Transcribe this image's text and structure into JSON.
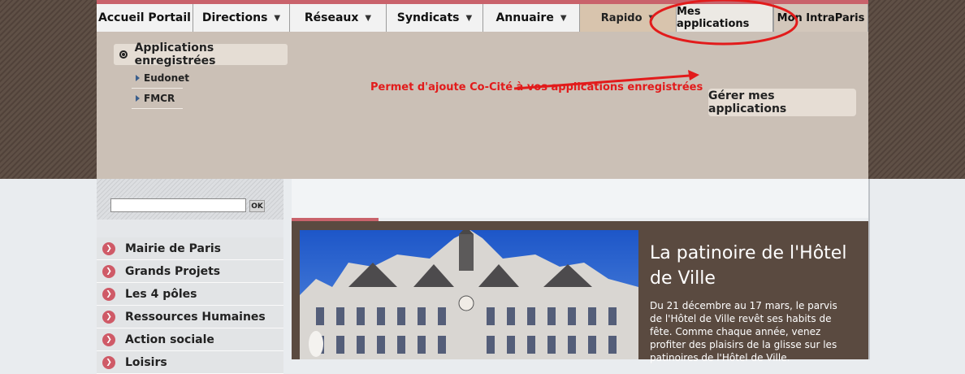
{
  "nav": {
    "items": [
      {
        "label": "Accueil Portail"
      },
      {
        "label": "Directions"
      },
      {
        "label": "Réseaux"
      },
      {
        "label": "Syndicats"
      },
      {
        "label": "Annuaire"
      },
      {
        "label": "Rapido"
      },
      {
        "label": "Mes applications"
      },
      {
        "label": "Mon IntraParis"
      }
    ]
  },
  "apps_panel": {
    "header": "Applications enregistrées",
    "links": [
      "Eudonet",
      "FMCR"
    ],
    "annotation": "Permet d'ajoute Co-Cité à vos applications enregistrées",
    "manage_button": "Gérer mes applications"
  },
  "search": {
    "ok_label": "OK",
    "value": ""
  },
  "sidebar_menu": [
    "Mairie de Paris",
    "Grands Projets",
    "Les 4 pôles",
    "Ressources Humaines",
    "Action sociale",
    "Loisirs"
  ],
  "feature": {
    "title": "La patinoire de l'Hôtel de Ville",
    "text": "Du 21 décembre au 17 mars, le parvis de l'Hôtel de Ville revêt ses habits de fête. Comme chaque année, venez profiter des plaisirs de la glisse sur les patinoires de l'Hôtel de Ville."
  },
  "colors": {
    "accent": "#c9626b",
    "annotation_red": "#e21b1b",
    "panel": "#cbc0b6",
    "feature_bg": "#5a4a40"
  }
}
